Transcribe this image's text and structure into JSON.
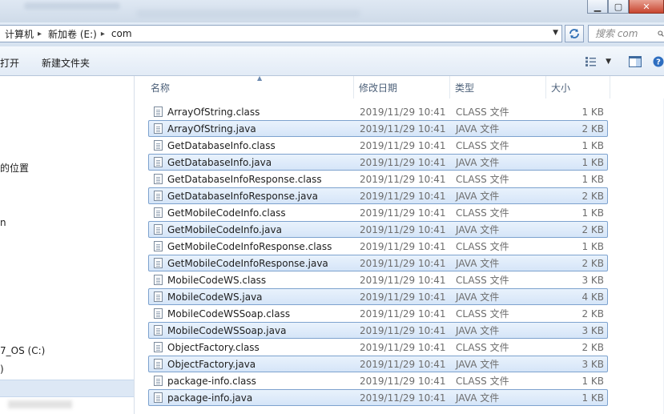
{
  "window": {
    "minimize_label": "▁",
    "maximize_label": "▢",
    "close_label": "✕"
  },
  "address": {
    "crumbs": [
      "计算机",
      "新加卷 (E:)",
      "com"
    ],
    "search_placeholder": "搜索 com"
  },
  "toolbar": {
    "open_label": "打开",
    "new_folder_label": "新建文件夹"
  },
  "nav": {
    "items": [
      {
        "label": "的位置"
      },
      {
        "label": "n"
      },
      {
        "label": "7_OS (C:)"
      },
      {
        "label": ")"
      }
    ]
  },
  "columns": {
    "name": "名称",
    "date": "修改日期",
    "type": "类型",
    "size": "大小"
  },
  "files": [
    {
      "name": "ArrayOfString.class",
      "date": "2019/11/29 10:41",
      "type": "CLASS 文件",
      "size": "1 KB",
      "selected": false
    },
    {
      "name": "ArrayOfString.java",
      "date": "2019/11/29 10:41",
      "type": "JAVA 文件",
      "size": "2 KB",
      "selected": true
    },
    {
      "name": "GetDatabaseInfo.class",
      "date": "2019/11/29 10:41",
      "type": "CLASS 文件",
      "size": "1 KB",
      "selected": false
    },
    {
      "name": "GetDatabaseInfo.java",
      "date": "2019/11/29 10:41",
      "type": "JAVA 文件",
      "size": "1 KB",
      "selected": true
    },
    {
      "name": "GetDatabaseInfoResponse.class",
      "date": "2019/11/29 10:41",
      "type": "CLASS 文件",
      "size": "1 KB",
      "selected": false
    },
    {
      "name": "GetDatabaseInfoResponse.java",
      "date": "2019/11/29 10:41",
      "type": "JAVA 文件",
      "size": "2 KB",
      "selected": true
    },
    {
      "name": "GetMobileCodeInfo.class",
      "date": "2019/11/29 10:41",
      "type": "CLASS 文件",
      "size": "1 KB",
      "selected": false
    },
    {
      "name": "GetMobileCodeInfo.java",
      "date": "2019/11/29 10:41",
      "type": "JAVA 文件",
      "size": "2 KB",
      "selected": true
    },
    {
      "name": "GetMobileCodeInfoResponse.class",
      "date": "2019/11/29 10:41",
      "type": "CLASS 文件",
      "size": "1 KB",
      "selected": false
    },
    {
      "name": "GetMobileCodeInfoResponse.java",
      "date": "2019/11/29 10:41",
      "type": "JAVA 文件",
      "size": "2 KB",
      "selected": true
    },
    {
      "name": "MobileCodeWS.class",
      "date": "2019/11/29 10:41",
      "type": "CLASS 文件",
      "size": "3 KB",
      "selected": false
    },
    {
      "name": "MobileCodeWS.java",
      "date": "2019/11/29 10:41",
      "type": "JAVA 文件",
      "size": "4 KB",
      "selected": true
    },
    {
      "name": "MobileCodeWSSoap.class",
      "date": "2019/11/29 10:41",
      "type": "CLASS 文件",
      "size": "2 KB",
      "selected": false
    },
    {
      "name": "MobileCodeWSSoap.java",
      "date": "2019/11/29 10:41",
      "type": "JAVA 文件",
      "size": "3 KB",
      "selected": true
    },
    {
      "name": "ObjectFactory.class",
      "date": "2019/11/29 10:41",
      "type": "CLASS 文件",
      "size": "2 KB",
      "selected": false
    },
    {
      "name": "ObjectFactory.java",
      "date": "2019/11/29 10:41",
      "type": "JAVA 文件",
      "size": "3 KB",
      "selected": true
    },
    {
      "name": "package-info.class",
      "date": "2019/11/29 10:41",
      "type": "CLASS 文件",
      "size": "1 KB",
      "selected": false
    },
    {
      "name": "package-info.java",
      "date": "2019/11/29 10:41",
      "type": "JAVA 文件",
      "size": "1 KB",
      "selected": true
    }
  ],
  "icons": {
    "file": "document-icon",
    "folder": "folder-icon",
    "refresh": "refresh-icon",
    "search": "search-icon",
    "views": "view-options-icon",
    "preview": "preview-pane-icon",
    "help": "help-icon"
  },
  "colors": {
    "selection_fill": "#d5e5f8",
    "selection_border": "#7da2ce",
    "header_text": "#4b5f78",
    "secondary_text": "#6d6d6d"
  }
}
